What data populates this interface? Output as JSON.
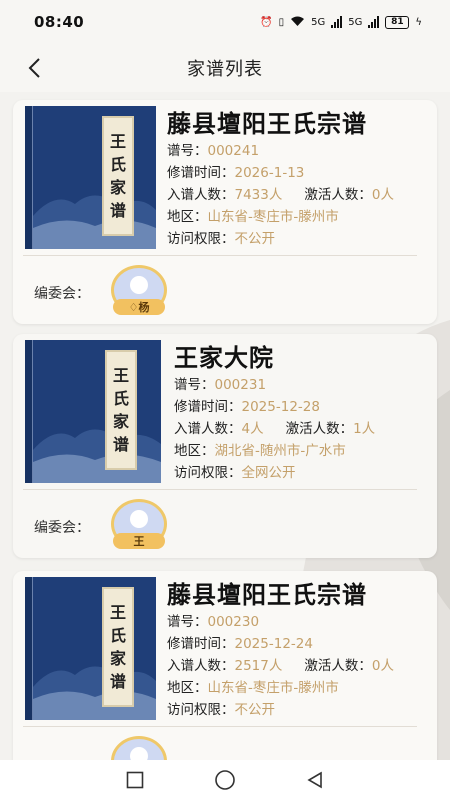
{
  "status": {
    "time": "08:40",
    "network1": "5G",
    "network2": "5G",
    "battery": "81"
  },
  "nav": {
    "title": "家谱列表"
  },
  "labels": {
    "no": "谱号：",
    "date": "修谱时间：",
    "members": "入谱人数：",
    "active": "激活人数：",
    "region": "地区：",
    "access": "访问权限：",
    "committee": "编委会："
  },
  "cover_text": [
    "王",
    "氏",
    "家",
    "谱"
  ],
  "cards": [
    {
      "title": "藤县壇阳王氏宗谱",
      "no": "000241",
      "date": "2026-1-13",
      "members": "7433人",
      "active": "0人",
      "region": "山东省-枣庄市-滕州市",
      "access": "不公开",
      "avatar_badge": "杨"
    },
    {
      "title": "王家大院",
      "no": "000231",
      "date": "2025-12-28",
      "members": "4人",
      "active": "1人",
      "region": "湖北省-随州市-广水市",
      "access": "全网公开",
      "avatar_badge": "王"
    },
    {
      "title": "藤县壇阳王氏宗谱",
      "no": "000230",
      "date": "2025-12-24",
      "members": "2517人",
      "active": "0人",
      "region": "山东省-枣庄市-滕州市",
      "access": "不公开",
      "avatar_badge": ""
    }
  ],
  "colors": {
    "accent": "#c4a06a",
    "cover": "#1f3e78",
    "badge": "#f2c160"
  }
}
